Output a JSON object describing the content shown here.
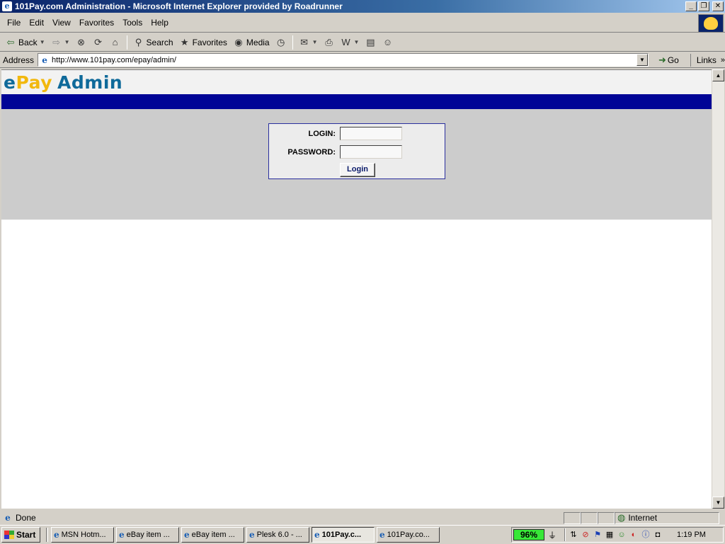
{
  "window": {
    "title": "101Pay.com Administration - Microsoft Internet Explorer provided by Roadrunner",
    "icon": "ie-icon",
    "controls": [
      "minimize",
      "maximize",
      "close"
    ]
  },
  "menu": [
    "File",
    "Edit",
    "View",
    "Favorites",
    "Tools",
    "Help"
  ],
  "toolbar": {
    "back": "Back",
    "search": "Search",
    "favorites": "Favorites",
    "media": "Media"
  },
  "address": {
    "label": "Address",
    "url": "http://www.101pay.com/epay/admin/",
    "go": "Go",
    "links": "Links"
  },
  "page": {
    "logo": {
      "e": "e",
      "pay": "Pay",
      "admin": "Admin"
    },
    "colors": {
      "nav_band": "#000596",
      "logo_blue": "#0f6a9a",
      "logo_yellow": "#f2b80e",
      "login_area": "#cccccc"
    },
    "login_form": {
      "login_label": "LOGIN:",
      "password_label": "PASSWORD:",
      "login_value": "",
      "password_value": "",
      "submit": "Login"
    }
  },
  "status": {
    "text": "Done",
    "zone": "Internet"
  },
  "taskbar": {
    "start": "Start",
    "tasks": [
      {
        "label": "MSN Hotm...",
        "active": false
      },
      {
        "label": "eBay item ...",
        "active": false
      },
      {
        "label": "eBay item ...",
        "active": false
      },
      {
        "label": "Plesk 6.0 - ...",
        "active": false
      },
      {
        "label": "101Pay.c...",
        "active": true
      },
      {
        "label": "101Pay.co...",
        "active": false
      }
    ],
    "battery": "96%",
    "clock": "1:19 PM"
  }
}
